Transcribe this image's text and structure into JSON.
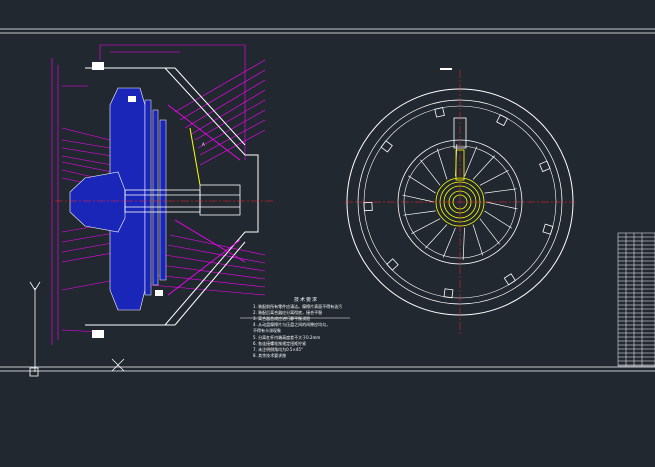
{
  "drawing": {
    "background": "#212830",
    "line_color": "#ffffff",
    "accent_magenta": "#ff00ff",
    "accent_blue": "#1a26b8",
    "accent_yellow": "#ffff00",
    "center_line_red": "#ff2222"
  },
  "technical_requirements": {
    "title": "技术要求",
    "items": [
      "1. 装配前所有零件应清洁。摩擦片表面不得有油污",
      "2. 装配后离合器应分离彻底，接合平稳",
      "3. 离合器总成应进行静平衡试验",
      "4. 从动盘摩擦片与压盘之间的间隙应均匀，",
      "不得有卡滞现象",
      "5. 分离杠杆内端高度差不大于0.2mm",
      "6. 各连接螺栓按规定扭矩拧紧",
      "7. 未注明倒角均为0.5×45°",
      "8. 其余技术要求按"
    ]
  },
  "icons": [
    "ucs-axis-icon",
    "crosshair-icon"
  ],
  "title_block": {
    "visible": true
  }
}
